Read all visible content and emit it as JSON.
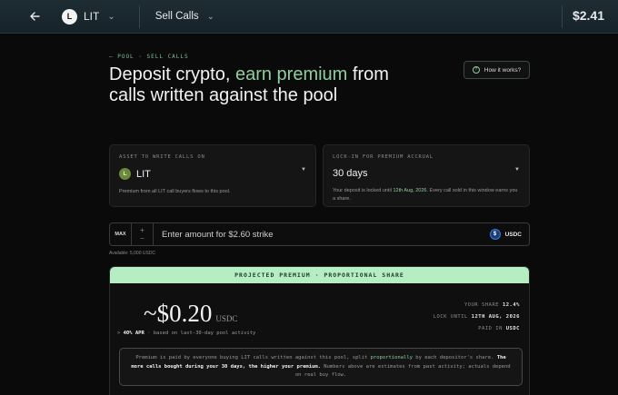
{
  "topbar": {
    "back_icon": "arrow-left-icon",
    "asset": {
      "badge": "L",
      "label": "LIT"
    },
    "page": {
      "label": "Sell Calls"
    },
    "price": "$2.41"
  },
  "hero": {
    "eyebrow": "— POOL · SELL CALLS",
    "title_pre": "Deposit crypto, ",
    "title_accent": "earn premium",
    "title_post": " from calls written against the pool",
    "how_label": "How it works?"
  },
  "asset_card": {
    "label": "ASSET TO WRITE CALLS ON",
    "value": "LIT",
    "badge": "L",
    "help": "Premium from all LIT call buyers flows to this pool."
  },
  "lock_card": {
    "label": "LOCK-IN FOR PREMIUM ACCRUAL",
    "value": "30 days",
    "help_pre": "Your deposit is locked until ",
    "help_date": "12th Aug, 2026",
    "help_post": ". Every call sold in this window earns you a share."
  },
  "amount": {
    "max_label": "MAX",
    "plus": "+",
    "minus": "−",
    "placeholder": "Enter amount for $2.60 strike",
    "currency": "USDC",
    "available": "Available: 5,000 USDC"
  },
  "projected": {
    "header": "PROJECTED PREMIUM · PROPORTIONAL SHARE",
    "amount": "~$0.20",
    "unit": "USDC",
    "apr_pre": "> ",
    "apr": "40% APR",
    "apr_post": " · based on last-30-day pool activity",
    "share_label": "YOUR SHARE",
    "share_value": "12.4%",
    "lock_label": "LOCK UNTIL",
    "lock_value": "12TH AUG, 2026",
    "paid_label": "PAID IN",
    "paid_value": "USDC",
    "note_a": "Premium is paid by everyone buying LIT calls written against this pool, split ",
    "note_hl": "proportionally",
    "note_b": " by each depositor's share. ",
    "note_bold": "The more calls bought during your 30 days, the higher your premium.",
    "note_c": " Numbers above are estimates from past activity; actuals depend on real buy flow."
  }
}
